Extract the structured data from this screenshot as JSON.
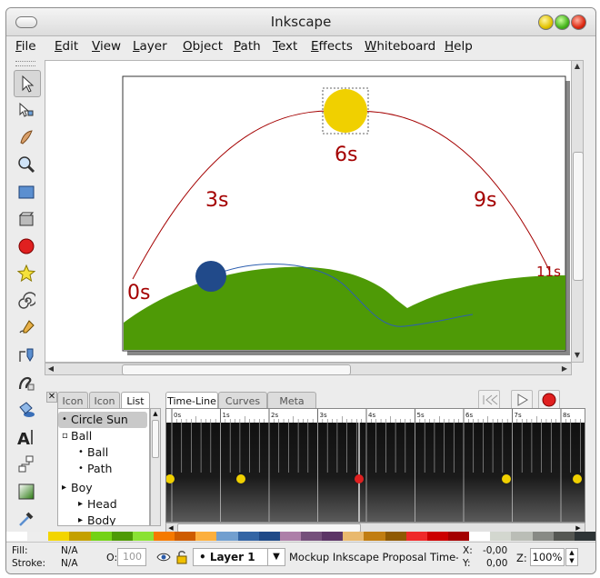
{
  "window": {
    "title": "Inkscape"
  },
  "menu": [
    {
      "u": "F",
      "rest": "ile"
    },
    {
      "u": "E",
      "rest": "dit"
    },
    {
      "u": "V",
      "rest": "iew"
    },
    {
      "u": "L",
      "rest": "ayer"
    },
    {
      "u": "O",
      "rest": "bject"
    },
    {
      "u": "P",
      "rest": "ath"
    },
    {
      "u": "T",
      "rest": "ext"
    },
    {
      "u": "E",
      "rest": "ffects"
    },
    {
      "u": "W",
      "rest": "hiteboard"
    },
    {
      "u": "H",
      "rest": "elp"
    }
  ],
  "tools": [
    "selector-tool-icon",
    "node-tool-icon",
    "tweak-tool-icon",
    "zoom-tool-icon",
    "rectangle-tool-icon",
    "box-3d-tool-icon",
    "ellipse-tool-icon",
    "star-tool-icon",
    "spiral-tool-icon",
    "pencil-tool-icon",
    "pen-tool-icon",
    "calligraphy-tool-icon",
    "paint-bucket-tool-icon",
    "text-tool-icon",
    "connector-tool-icon",
    "gradient-tool-icon",
    "dropper-tool-icon"
  ],
  "canvas": {
    "labels": [
      "0s",
      "3s",
      "6s",
      "9s",
      "11s"
    ],
    "colors": {
      "hill": "#4e9a06",
      "sun": "#f0d000",
      "ball": "#214a8a",
      "arc": "#a40000"
    }
  },
  "objects": {
    "tabs": [
      "Icon",
      "Icon",
      "List"
    ],
    "items": [
      {
        "bullet": "•",
        "label": "Circle Sun",
        "indent": 0
      },
      {
        "bullet": "▫",
        "label": "Ball",
        "indent": 0
      },
      {
        "bullet": "•",
        "label": "Ball",
        "indent": 1
      },
      {
        "bullet": "•",
        "label": "Path",
        "indent": 1
      },
      {
        "bullet": "▸",
        "label": "Boy",
        "indent": 0
      },
      {
        "bullet": "▸",
        "label": "Head",
        "indent": 1
      },
      {
        "bullet": "▸",
        "label": "Body",
        "indent": 1
      }
    ]
  },
  "timeline": {
    "tabs": [
      "Time-Line",
      "Curves",
      "Meta"
    ],
    "ruler": [
      "0s",
      "1s",
      "2s",
      "3s",
      "4s",
      "5s",
      "6s",
      "7s",
      "8s",
      "9s",
      "10s"
    ],
    "keyframes": [
      0,
      1.5,
      4,
      7,
      8.5
    ],
    "playhead": 4
  },
  "palette": [
    "#ffffff",
    "#ededed",
    "#f3d500",
    "#c4a000",
    "#73d216",
    "#4e9a06",
    "#8ae234",
    "#f57900",
    "#ce5c00",
    "#fcaf3e",
    "#729fcf",
    "#3465a4",
    "#204a87",
    "#ad7fa8",
    "#75507b",
    "#5c3566",
    "#e9b96e",
    "#c17d11",
    "#8f5902",
    "#ef2929",
    "#cc0000",
    "#a40000",
    "#ffffff",
    "#d3d7cf",
    "#babdb6",
    "#888a85",
    "#555753",
    "#2e3436"
  ],
  "status": {
    "fill_label": "Fill:",
    "fill_value": "N/A",
    "stroke_label": "Stroke:",
    "stroke_value": "N/A",
    "opacity_label": "O:",
    "opacity_value": "100",
    "layer": "• Layer 1",
    "message": "Mockup Inkscape Proposal Time-...",
    "x_label": "X:",
    "x_value": "-0,00",
    "y_label": "Y:",
    "y_value": "0,00",
    "zoom_label": "Z:",
    "zoom_value": "100%"
  }
}
